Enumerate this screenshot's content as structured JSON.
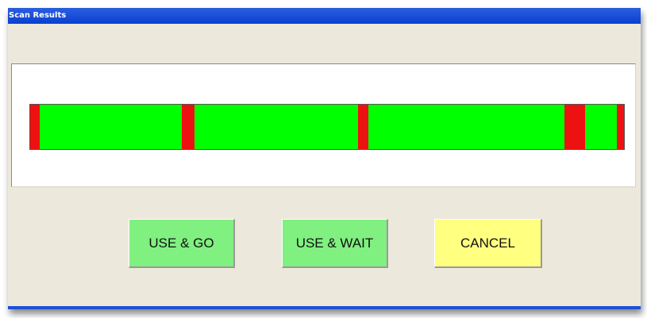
{
  "window": {
    "title": "Scan Results"
  },
  "scan_bar": {
    "colors": {
      "ok": "#00ff00",
      "error": "#ee1111"
    },
    "error_segments": [
      {
        "start": 0.0,
        "end": 0.016
      },
      {
        "start": 0.255,
        "end": 0.277
      },
      {
        "start": 0.552,
        "end": 0.569
      },
      {
        "start": 0.9,
        "end": 0.934
      },
      {
        "start": 0.988,
        "end": 1.0
      }
    ]
  },
  "buttons": {
    "use_go": "USE & GO",
    "use_wait": "USE & WAIT",
    "cancel": "CANCEL"
  },
  "colors": {
    "titlebar": "#0b3fd0",
    "window_bg": "#ece8dc",
    "button_green": "#80f080",
    "button_yellow": "#ffff80"
  }
}
